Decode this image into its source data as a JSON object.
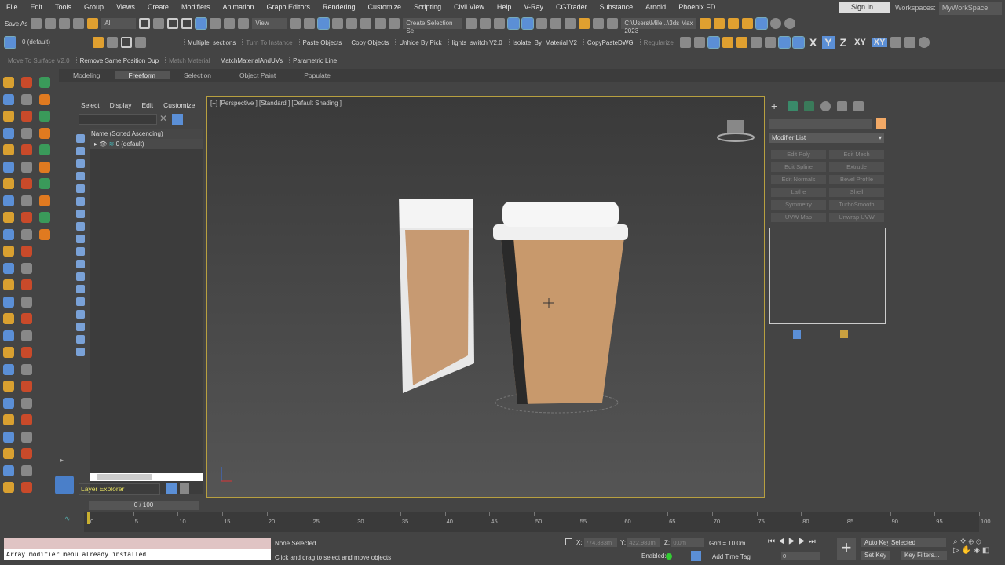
{
  "menu": [
    "File",
    "Edit",
    "Tools",
    "Group",
    "Views",
    "Create",
    "Modifiers",
    "Animation",
    "Graph Editors",
    "Rendering",
    "Customize",
    "Scripting",
    "Civil View",
    "Help",
    "V-Ray",
    "CGTrader",
    "Substance",
    "Arnold",
    "Phoenix FD"
  ],
  "account": {
    "sign_in": "Sign In",
    "workspaces_label": "Workspaces:",
    "workspace": "MyWorkSpace"
  },
  "toolbar1": {
    "save_as": "Save As",
    "filter": "All",
    "ref_coord": "View",
    "selection_set": "Create Selection Se",
    "project_path": "C:\\Users\\Mile...\\3ds Max 2023"
  },
  "toolbar2": {
    "layer": "0 (default)",
    "scripts": [
      "Multiple_sections",
      "Turn To Instance",
      "Paste Objects",
      "Copy Objects",
      "Unhide By Pick",
      "lights_switch V2.0",
      "Isolate_By_Material V2",
      "CopyPasteDWG",
      "Regularize"
    ],
    "axes": [
      "X",
      "Y",
      "Z",
      "XY",
      "XY"
    ]
  },
  "toolbar3": {
    "scripts": [
      "Move To Surface V2.0",
      "Remove Same Position Dup",
      "Match Material",
      "MatchMaterialAndUVs",
      "Parametric Line"
    ]
  },
  "ribbon": {
    "tabs": [
      "Modeling",
      "Freeform",
      "Selection",
      "Object Paint",
      "Populate"
    ],
    "active": "Freeform"
  },
  "explorer": {
    "menu": [
      "Select",
      "Display",
      "Edit",
      "Customize"
    ],
    "column_header": "Name (Sorted Ascending)",
    "rows": [
      {
        "label": "0 (default)"
      }
    ],
    "layer_explorer": "Layer Explorer"
  },
  "viewport": {
    "label": "[+] [Perspective ] [Standard ] [Default Shading ]"
  },
  "command_panel": {
    "modifier_list": "Modifier List",
    "modifiers": [
      "Edit Poly",
      "Edit Mesh",
      "Edit Spline",
      "Extrude",
      "Edit Normals",
      "Bevel Profile",
      "Lathe",
      "Shell",
      "Symmetry",
      "TurboSmooth",
      "UVW Map",
      "Unwrap UVW"
    ],
    "swatch_color": "#f2a966"
  },
  "timeline": {
    "frame": "0 / 100",
    "ticks": [
      0,
      5,
      10,
      15,
      20,
      25,
      30,
      35,
      40,
      45,
      50,
      55,
      60,
      65,
      70,
      75,
      80,
      85,
      90,
      95,
      100
    ]
  },
  "status": {
    "listener_output": "Array modifier menu already installed",
    "selection": "None Selected",
    "prompt": "Click and drag to select and move objects",
    "x_label": "X:",
    "x": "774.883m",
    "y_label": "Y:",
    "y": "422.983m",
    "z_label": "Z:",
    "z": "0.0m",
    "grid": "Grid = 10.0m",
    "enabled": "Enabled:",
    "add_time_tag": "Add Time Tag",
    "current_frame": "0",
    "auto_key": "Auto Key",
    "set_key": "Set Key",
    "key_mode": "Selected",
    "key_filters": "Key Filters..."
  }
}
